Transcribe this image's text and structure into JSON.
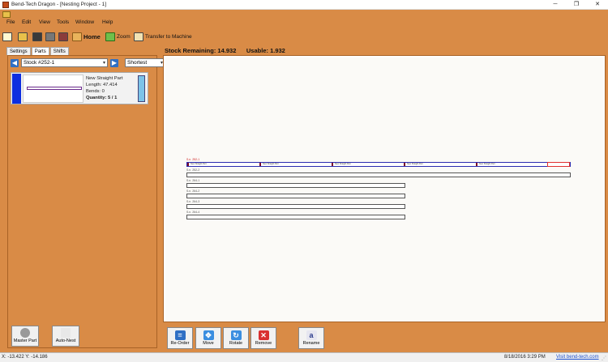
{
  "window": {
    "title": "Bend-Tech Dragon - [Nesting Project - 1]",
    "minimize_glyph": "─",
    "maximize_glyph": "❐",
    "close_glyph": "✕"
  },
  "menu": {
    "items": [
      "File",
      "Edit",
      "View",
      "Tools",
      "Window",
      "Help"
    ]
  },
  "toolbar": {
    "home_label": "Home",
    "zoom_label": "Zoom",
    "transfer_label": "Transfer to Machine"
  },
  "left_panel": {
    "tabs": [
      "Settings",
      "Parts",
      "Shifts"
    ],
    "active_tab": "Parts",
    "stock_select": "Stock #252-1",
    "sort_select": "Shortest",
    "part": {
      "name": "New Straight Part",
      "length": "Length: 47.414",
      "bends": "Bends: 0",
      "quantity": "Quantity: 5 / 1"
    },
    "buttons": {
      "master_part": "Master Part",
      "auto_nest": "Auto-Nest"
    }
  },
  "nest_area": {
    "stock_remaining": "Stock Remaining: 14.932",
    "usable": "Usable: 1.932",
    "bar_labels": [
      "S.n. 252-1",
      "S.n. 252-2",
      "S.n. 264-1",
      "S.n. 264-2",
      "S.n. 264-3",
      "S.n. 264-4"
    ],
    "segment_label": "New Straight Part"
  },
  "actions": {
    "reorder": "Re-Order",
    "move": "Move",
    "rotate": "Rotate",
    "remove": "Remove",
    "rename": "Rename"
  },
  "status": {
    "coords": "X: -13.422  Y: -14.186",
    "datetime": "8/18/2016   3:29 PM",
    "link": "Visit bend-tech.com"
  },
  "colors": {
    "background": "#d98b46",
    "part_blue": "#0d2ee0",
    "segment_dark_red": "#7a0b2a",
    "remnant_red": "#e03030"
  }
}
